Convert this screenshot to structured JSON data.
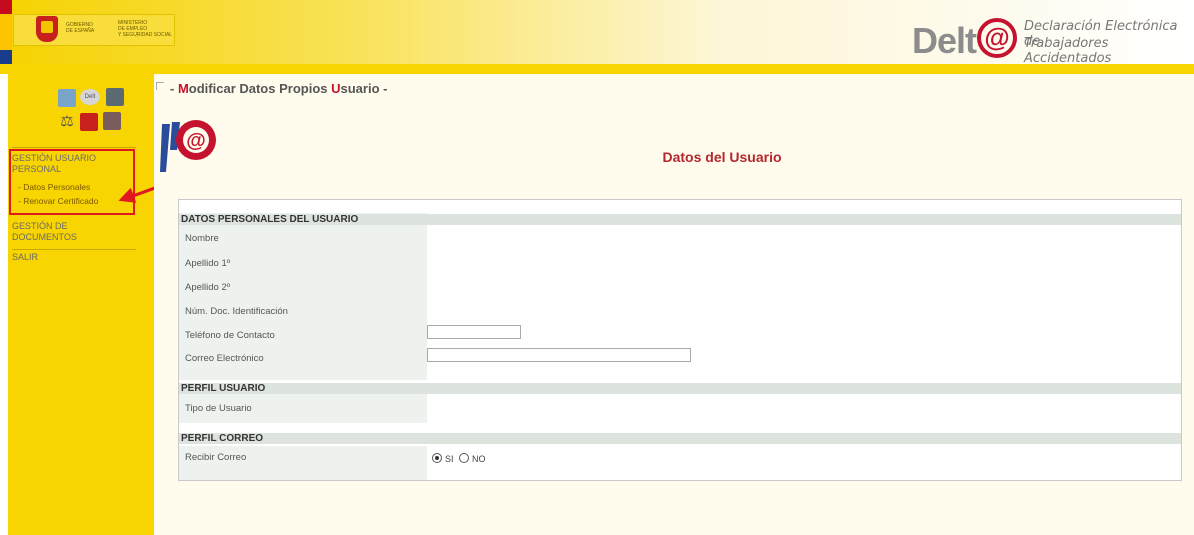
{
  "header": {
    "gov_labels": [
      "GOBIERNO",
      "DE ESPAÑA"
    ],
    "ministry_labels": [
      "MINISTERIO",
      "DE EMPLEO",
      "Y SEGURIDAD SOCIAL"
    ],
    "brand_main": "Delt",
    "brand_at": "@",
    "brand_subtitle_1": "Declaración Electrónica de",
    "brand_subtitle_2": "Trabajadores Accidentados"
  },
  "sidebar": {
    "icon_text": "Delt",
    "menu": [
      {
        "label": "GESTIÓN USUARIO PERSONAL",
        "subitems": [
          "- Datos Personales",
          "- Renovar Certificado"
        ]
      },
      {
        "label": "GESTIÓN DE DOCUMENTOS"
      },
      {
        "label": "SALIR"
      }
    ]
  },
  "page": {
    "title_prefix": "- ",
    "title_m": "M",
    "title_mid": "odificar Datos Propios ",
    "title_u": "U",
    "title_end": "suario -",
    "section_title": "Datos del Usuario",
    "logo_glyph": "@"
  },
  "form": {
    "sections": [
      {
        "title": "DATOS PERSONALES DEL USUARIO",
        "fields": [
          {
            "label": "Nombre",
            "value": ""
          },
          {
            "label": "Apellido 1º",
            "value": ""
          },
          {
            "label": "Apellido 2º",
            "value": ""
          },
          {
            "label": "Núm. Doc. Identificación",
            "value": ""
          },
          {
            "label": "Teléfono de Contacto",
            "value": ""
          },
          {
            "label": "Correo Electrónico",
            "value": ""
          }
        ]
      },
      {
        "title": "PERFIL USUARIO",
        "fields": [
          {
            "label": "Tipo de Usuario",
            "value": ""
          }
        ]
      },
      {
        "title": "PERFIL CORREO",
        "fields": [
          {
            "label": "Recibir Correo",
            "options": [
              "SI",
              "NO"
            ],
            "selected": "SI"
          }
        ]
      }
    ]
  },
  "colors": {
    "accent_red": "#c4122f",
    "sidebar_yellow": "#f8d400",
    "band_gray": "#dde3dd"
  }
}
